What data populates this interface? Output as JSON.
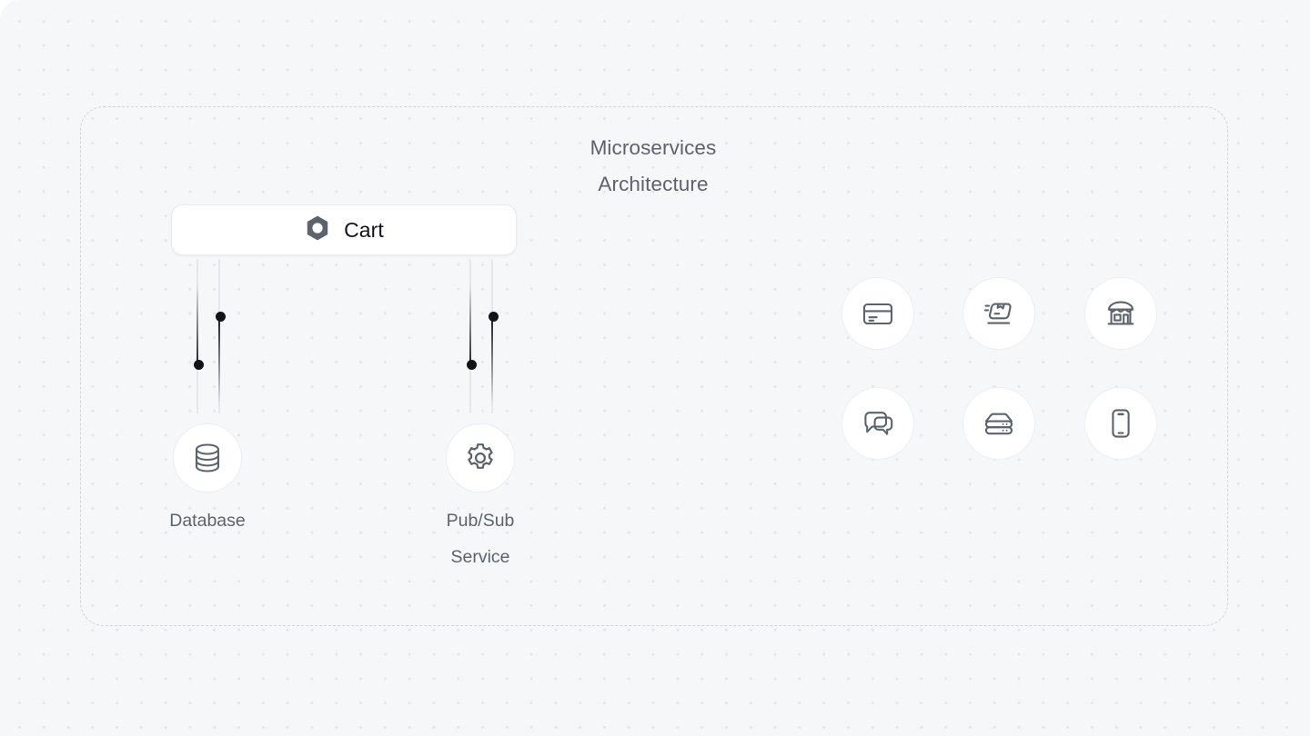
{
  "canvas": {
    "background_color": "#f6f7f9",
    "dot_color": "#e2e5ea"
  },
  "group": {
    "title": "Microservices\nArchitecture",
    "border_style": "dashed",
    "border_color": "#cfd4da"
  },
  "cart": {
    "label": "Cart",
    "icon": "hex-nut-icon",
    "icon_color": "#5c636d",
    "background": "#ffffff"
  },
  "edges": [
    {
      "name": "cart-to-database",
      "from": "Cart",
      "to": "Database",
      "track_color": "#e4e7eb",
      "pulse_color": "#111319"
    },
    {
      "name": "cart-to-pubsub",
      "from": "Cart",
      "to": "Pub/Sub Service",
      "track_color": "#e4e7eb",
      "pulse_color": "#111319"
    }
  ],
  "nodes": [
    {
      "label": "Database",
      "icon": "database-icon"
    },
    {
      "label": "Pub/Sub\nService",
      "icon": "gear-icon"
    }
  ],
  "icon_grid": {
    "rows": 2,
    "columns": 3,
    "items": [
      {
        "icon": "credit-card-icon",
        "name": "payments"
      },
      {
        "icon": "shipping-package-icon",
        "name": "shipping"
      },
      {
        "icon": "storefront-icon",
        "name": "storefront"
      },
      {
        "icon": "chat-bubbles-icon",
        "name": "messaging"
      },
      {
        "icon": "server-stack-icon",
        "name": "server"
      },
      {
        "icon": "mobile-phone-icon",
        "name": "mobile"
      }
    ]
  },
  "colors": {
    "icon_stroke": "#5c636d",
    "text_muted": "#5c636d",
    "text_strong": "#12141a"
  }
}
